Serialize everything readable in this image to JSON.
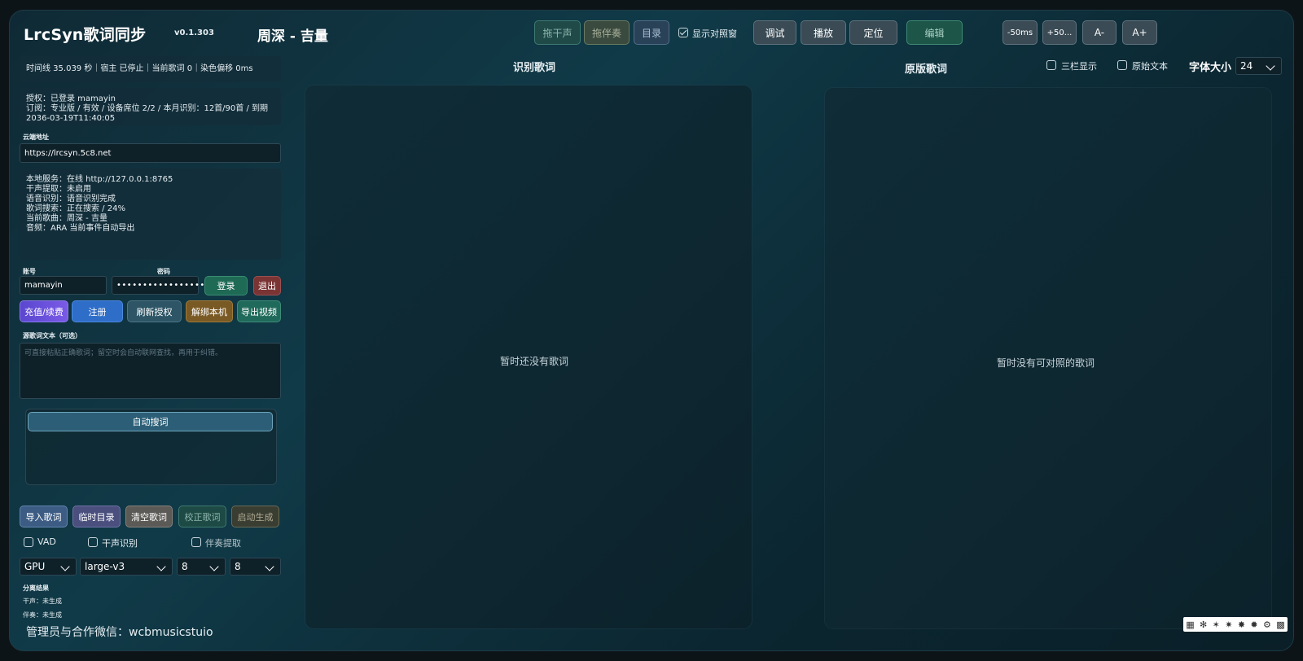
{
  "header": {
    "app_title": "LrcSyn歌词同步",
    "version": "v0.1.303",
    "song": "周深 - 吉量"
  },
  "toolbar": {
    "vocal": "拖干声",
    "accomp": "拖伴奏",
    "catalog": "目录",
    "show_compare_label": "显示对照窗",
    "show_compare_checked": true,
    "debug": "调试",
    "play": "播放",
    "locate": "定位",
    "edit": "编辑",
    "minus50": "-50ms",
    "plus50": "+50...",
    "font_minus": "A-",
    "font_plus": "A+"
  },
  "status": {
    "timeline": "时间线 35.039 秒｜宿主 已停止｜当前歌词 0｜染色偏移 0ms"
  },
  "license": {
    "line1": "授权：已登录 mamayin",
    "line2": "订阅：专业版 / 有效 / 设备席位 2/2 / 本月识别：12首/90首 / 到期",
    "line3": "2036-03-19T11:40:05"
  },
  "cloud": {
    "label": "云端地址",
    "value": "https://lrcsyn.5c8.net"
  },
  "service": {
    "lines": [
      "本地服务：在线 http://127.0.0.1:8765",
      "干声提取：未启用",
      "语音识别：语音识别完成",
      "歌词搜索：正在搜索 / 24%",
      "当前歌曲：周深 - 吉量",
      "音频：ARA 当前事件自动导出"
    ]
  },
  "account": {
    "account_label": "账号",
    "password_label": "密码",
    "username": "mamayin",
    "password_mask": "••••••••••••••••••",
    "login": "登录",
    "logout": "退出",
    "recharge": "充值/续费",
    "register": "注册",
    "refresh": "刷新授权",
    "unbind": "解绑本机",
    "export_video": "导出视频"
  },
  "source_lyrics": {
    "label": "源歌词文本（可选）",
    "placeholder": "可直接粘贴正确歌词；留空时会自动联网查找，再用于纠错。"
  },
  "search": {
    "auto_search": "自动搜词"
  },
  "actions": {
    "import": "导入歌词",
    "temp_dir": "临时目录",
    "clear": "清空歌词",
    "correct": "校正歌词",
    "generate": "启动生成"
  },
  "options": {
    "vad": "VAD",
    "vad_checked": false,
    "vocal_recog": "干声识别",
    "vocal_recog_checked": false,
    "accomp_extract": "伴奏提取",
    "accomp_extract_checked": false
  },
  "selects": {
    "device": "GPU",
    "model": "large-v3",
    "opt1": "8",
    "opt2": "8"
  },
  "separation": {
    "title": "分离结果",
    "vocal": "干声：未生成",
    "accomp": "伴奏：未生成"
  },
  "footer": {
    "contact": "管理员与合作微信：wcbmusicstuio"
  },
  "recognized": {
    "title": "识别歌词",
    "empty": "暂时还没有歌词"
  },
  "original": {
    "title": "原版歌词",
    "empty": "暂时没有可对照的歌词",
    "three_col": "三栏显示",
    "raw_text": "原始文本",
    "font_size_label": "字体大小",
    "font_size": "24"
  },
  "colors": {
    "accent_purple": "#6a4fd6",
    "accent_blue": "#2f6ec8",
    "login_green": "#1f6a55",
    "logout_red": "#7a3434"
  }
}
